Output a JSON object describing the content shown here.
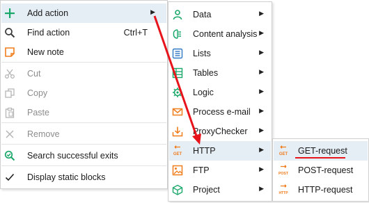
{
  "menu": {
    "add_action": "Add action",
    "find_action": "Find action",
    "find_shortcut": "Ctrl+T",
    "new_note": "New note",
    "cut": "Cut",
    "copy": "Copy",
    "paste": "Paste",
    "remove": "Remove",
    "search_exits": "Search successful exits",
    "display_static": "Display static blocks"
  },
  "submenu": {
    "data": "Data",
    "content_analysis": "Content analysis",
    "lists": "Lists",
    "tables": "Tables",
    "logic": "Logic",
    "process_email": "Process e-mail",
    "proxychecker": "ProxyChecker",
    "http": "HTTP",
    "ftp": "FTP",
    "project": "Project"
  },
  "http_submenu": {
    "get": "GET-request",
    "post": "POST-request",
    "http": "HTTP-request"
  },
  "icon_tags": {
    "get": "GET",
    "post": "POST",
    "http": "HTTP"
  },
  "colors": {
    "accent_orange": "#f07c1a",
    "icon_green": "#1aa86a",
    "icon_blue": "#2f78c4",
    "annotation_red": "#e8141c",
    "highlight": "#e5edf5"
  }
}
